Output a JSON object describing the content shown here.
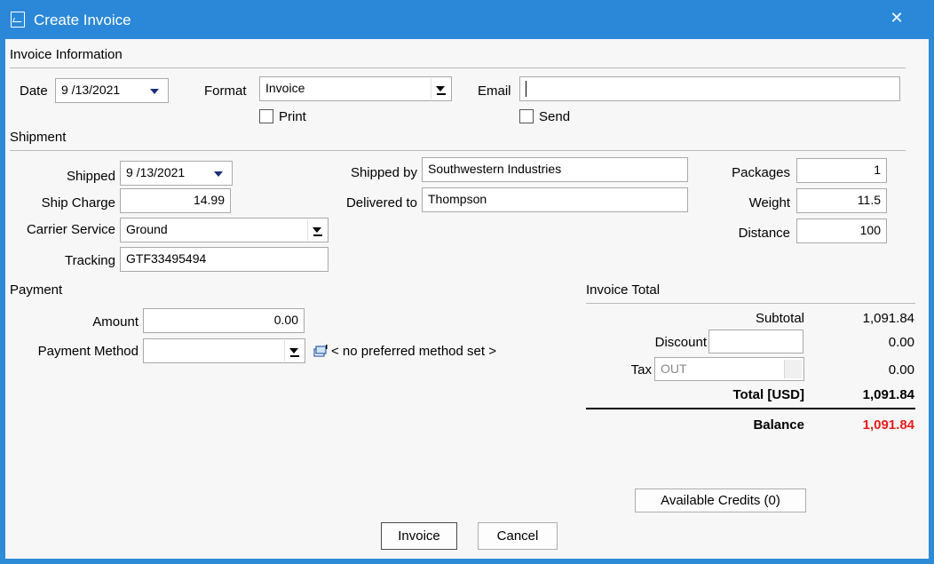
{
  "window": {
    "title": "Create Invoice",
    "close_glyph": "✕"
  },
  "invoice_info": {
    "section_label": "Invoice Information",
    "date_label": "Date",
    "date_value": "9 /13/2021",
    "format_label": "Format",
    "format_value": "Invoice",
    "print_label": "Print",
    "email_label": "Email",
    "email_value": "",
    "send_label": "Send"
  },
  "shipment": {
    "section_label": "Shipment",
    "shipped_label": "Shipped",
    "shipped_value": "9 /13/2021",
    "ship_charge_label": "Ship Charge",
    "ship_charge_value": "14.99",
    "carrier_label": "Carrier Service",
    "carrier_value": "Ground",
    "tracking_label": "Tracking",
    "tracking_value": "GTF33495494",
    "shipped_by_label": "Shipped by",
    "shipped_by_value": "Southwestern Industries",
    "delivered_to_label": "Delivered to",
    "delivered_to_value": "Thompson",
    "packages_label": "Packages",
    "packages_value": "1",
    "weight_label": "Weight",
    "weight_value": "11.5",
    "distance_label": "Distance",
    "distance_value": "100"
  },
  "payment": {
    "section_label": "Payment",
    "amount_label": "Amount",
    "amount_value": "0.00",
    "method_label": "Payment Method",
    "method_value": "",
    "preferred_text": "< no preferred method set >",
    "preferred_icon": "payment-method-settings-icon"
  },
  "invoice_total": {
    "section_label": "Invoice Total",
    "subtotal_label": "Subtotal",
    "subtotal_value": "1,091.84",
    "discount_label": "Discount",
    "discount_input": "",
    "discount_value": "0.00",
    "tax_label": "Tax",
    "tax_value_select": "OUT",
    "tax_value": "0.00",
    "total_label": "Total [USD]",
    "total_value": "1,091.84",
    "balance_label": "Balance",
    "balance_value": "1,091.84",
    "balance_color": "#e81b1b"
  },
  "buttons": {
    "available_credits": "Available Credits (0)",
    "invoice": "Invoice",
    "cancel": "Cancel"
  }
}
